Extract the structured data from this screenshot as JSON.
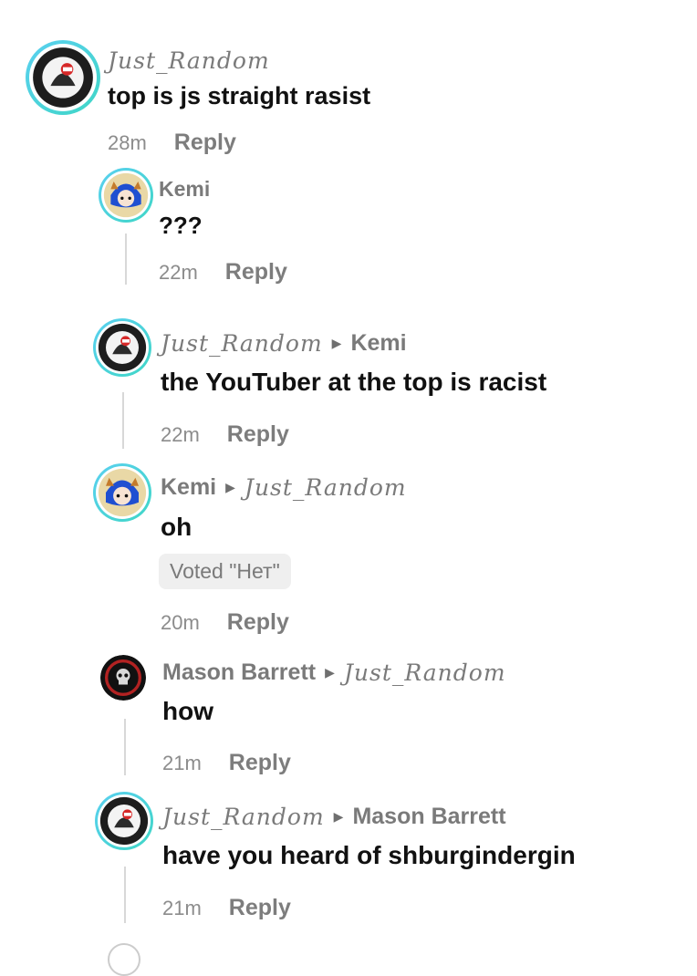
{
  "comments": [
    {
      "author": "Just_Random",
      "reply_to": "",
      "text": "top is js straight rasist",
      "time": "28m",
      "reply_label": "Reply"
    },
    {
      "author": "Kemi",
      "reply_to": "",
      "text": "???",
      "time": "22m",
      "reply_label": "Reply"
    },
    {
      "author": "Just_Random",
      "reply_to": "Kemi",
      "text": "the YouTuber at the top is racist",
      "time": "22m",
      "reply_label": "Reply"
    },
    {
      "author": "Kemi",
      "reply_to": "Just_Random",
      "text": "oh",
      "vote": "Voted \"Нет\"",
      "time": "20m",
      "reply_label": "Reply"
    },
    {
      "author": "Mason Barrett",
      "reply_to": "Just_Random",
      "text": "how",
      "time": "21m",
      "reply_label": "Reply"
    },
    {
      "author": "Just_Random",
      "reply_to": "Mason Barrett",
      "text": "have you heard of shburgindergin",
      "time": "21m",
      "reply_label": "Reply"
    }
  ],
  "colors": {
    "avatar_ring": "#4fd3e6",
    "text": "#111111",
    "muted": "#7a7a7a"
  },
  "icons": {
    "reply_arrow": "caret-right-icon"
  }
}
